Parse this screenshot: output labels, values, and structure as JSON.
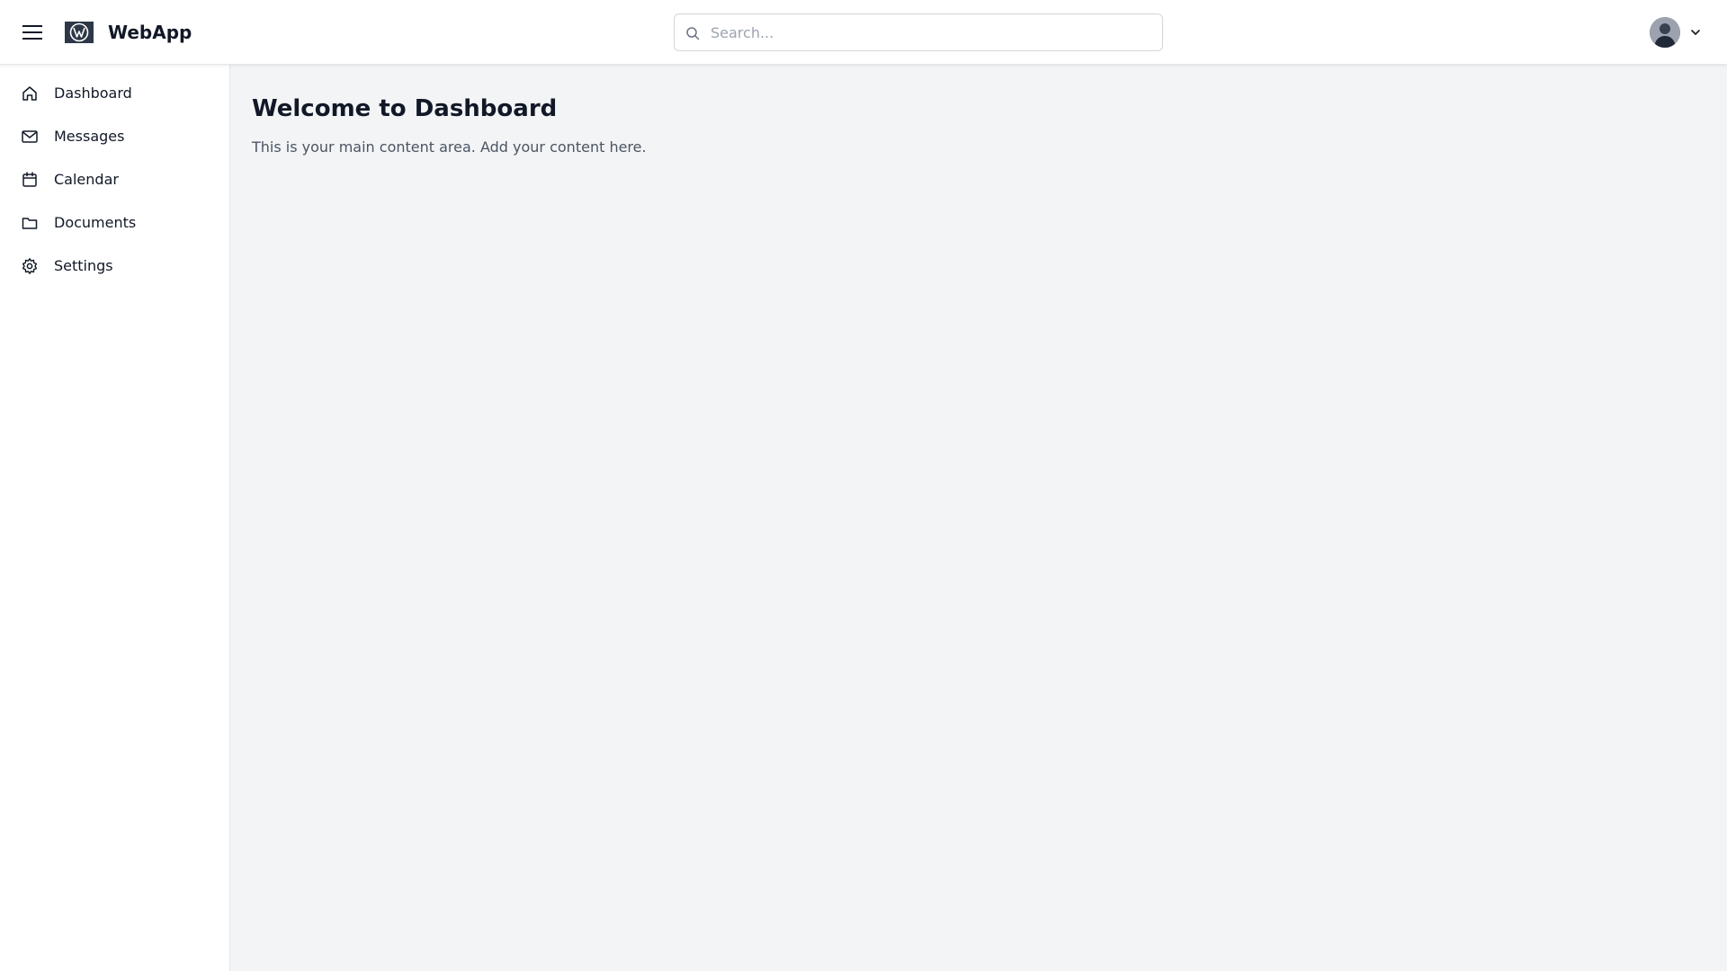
{
  "header": {
    "brand": "WebApp",
    "search_placeholder": "Search...",
    "search_value": ""
  },
  "sidebar": {
    "items": [
      {
        "label": "Dashboard",
        "icon": "home-icon"
      },
      {
        "label": "Messages",
        "icon": "mail-icon"
      },
      {
        "label": "Calendar",
        "icon": "calendar-icon"
      },
      {
        "label": "Documents",
        "icon": "folder-icon"
      },
      {
        "label": "Settings",
        "icon": "gear-icon"
      }
    ]
  },
  "main": {
    "title": "Welcome to Dashboard",
    "description": "This is your main content area. Add your content here."
  },
  "colors": {
    "header_bg": "#ffffff",
    "content_bg": "#f3f4f6",
    "logo_bg": "#2d3748",
    "text_primary": "#111827",
    "text_secondary": "#4b5563"
  }
}
